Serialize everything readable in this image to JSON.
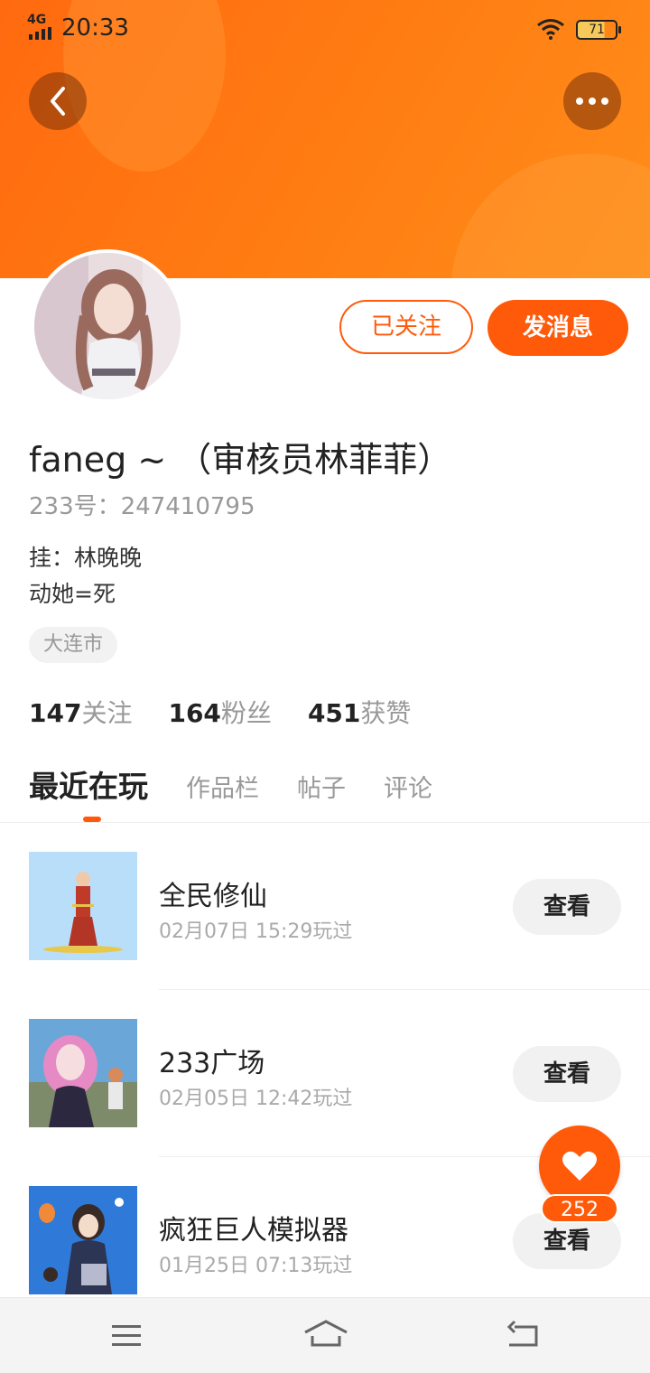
{
  "status_bar": {
    "network": "4G",
    "time": "20:33",
    "battery": "71"
  },
  "profile": {
    "name": "faneg ~ （审核员林菲菲）",
    "id_text": "233号：247410795",
    "bio_line1": "挂：林晚晚",
    "bio_line2": "动她=死",
    "location": "大连市",
    "follow_label": "已关注",
    "message_label": "发消息"
  },
  "stats": [
    {
      "num": "147",
      "label": "关注"
    },
    {
      "num": "164",
      "label": "粉丝"
    },
    {
      "num": "451",
      "label": "获赞"
    }
  ],
  "tabs": [
    "最近在玩",
    "作品栏",
    "帖子",
    "评论"
  ],
  "games": [
    {
      "name": "全民修仙",
      "time": "02月07日 15:29玩过",
      "button": "查看"
    },
    {
      "name": "233广场",
      "time": "02月05日 12:42玩过",
      "button": "查看"
    },
    {
      "name": "疯狂巨人模拟器",
      "time": "01月25日 07:13玩过",
      "button": "查看"
    }
  ],
  "like": {
    "count": "252"
  },
  "colors": {
    "accent": "#ff5a0a",
    "header": "#ff7a12"
  },
  "icons": [
    "back-icon",
    "more-icon",
    "wifi-icon",
    "battery-icon",
    "heart-icon",
    "menu-icon",
    "home-icon",
    "return-icon"
  ]
}
